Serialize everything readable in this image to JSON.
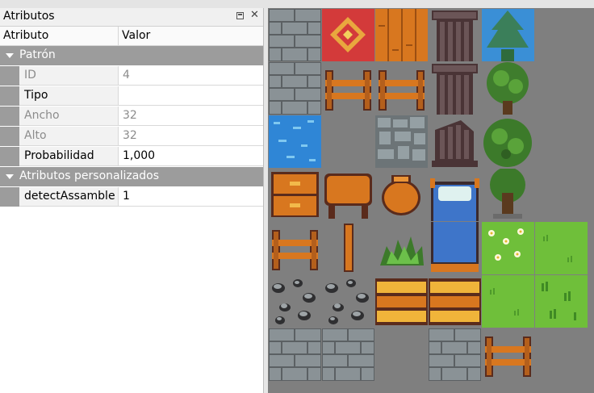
{
  "panel": {
    "title": "Atributos",
    "columns": {
      "name": "Atributo",
      "value": "Valor"
    },
    "groups": [
      {
        "label": "Patrón",
        "rows": [
          {
            "name": "ID",
            "value": "4",
            "enabled": false
          },
          {
            "name": "Tipo",
            "value": "",
            "enabled": true
          },
          {
            "name": "Ancho",
            "value": "32",
            "enabled": false
          },
          {
            "name": "Alto",
            "value": "32",
            "enabled": false
          },
          {
            "name": "Probabilidad",
            "value": "1,000",
            "enabled": true
          }
        ]
      },
      {
        "label": "Atributos personalizados",
        "rows": [
          {
            "name": "detectAssamble",
            "value": "1",
            "enabled": true
          }
        ]
      }
    ]
  },
  "tileset": {
    "background": "#7f7f7f",
    "tiles": [
      [
        "stone-wall",
        "red-carpet",
        "wood-planks",
        "stone-pillar",
        "tree-canopy-top",
        "empty"
      ],
      [
        "stone-wall",
        "wood-fence",
        "wood-fence",
        "stone-pillar",
        "tree-canopy",
        "empty"
      ],
      [
        "water",
        "empty",
        "cobblestone",
        "broken-pillar",
        "bush-tree",
        "empty"
      ],
      [
        "wood-chest",
        "wood-table",
        "clay-pot",
        "bed-top",
        "tree-trunk",
        "empty"
      ],
      [
        "wood-fence",
        "wood-post",
        "green-bush",
        "bed-bottom",
        "flower-grass",
        "grass"
      ],
      [
        "rocks",
        "rocks",
        "wood-bench",
        "wood-bench",
        "grass",
        "grass-tufts"
      ],
      [
        "stone-wall",
        "stone-wall",
        "empty",
        "stone-wall",
        "wood-fence",
        "empty"
      ]
    ]
  }
}
